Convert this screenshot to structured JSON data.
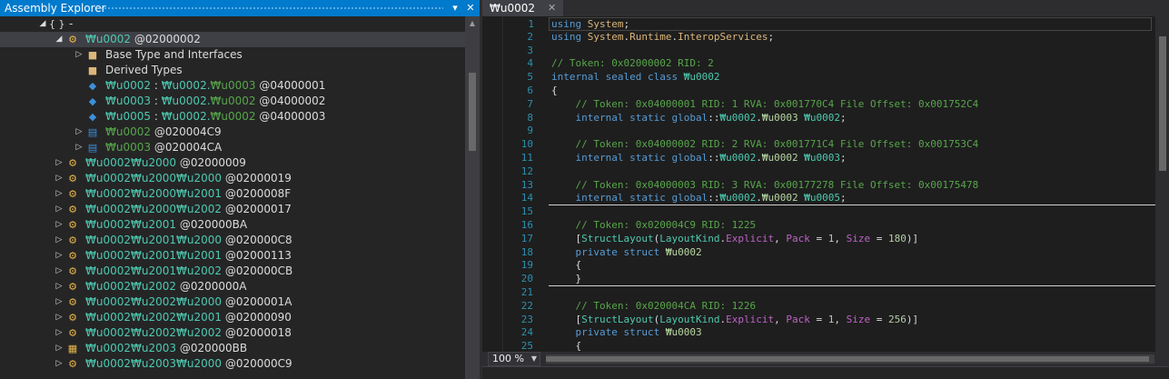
{
  "left_panel": {
    "title": "Assembly Explorer",
    "pin_icon": "pin-icon",
    "close_icon": "close-icon"
  },
  "tree": [
    {
      "indent": 42,
      "arrow": "◢",
      "icon": "braces-icon",
      "icon_glyph": "{ }",
      "parts": [
        {
          "t": "-",
          "c": "c-grey"
        }
      ]
    },
    {
      "indent": 60,
      "arrow": "◢",
      "icon": "class-icon",
      "icon_glyph": "⚙",
      "sel": true,
      "parts": [
        {
          "t": "₩u0002",
          "c": "c-teal"
        },
        {
          "t": " @02000002",
          "c": "c-grey"
        }
      ]
    },
    {
      "indent": 82,
      "arrow": "▷",
      "icon": "folder-icon",
      "icon_glyph": "■",
      "parts": [
        {
          "t": "Base Type and Interfaces",
          "c": "c-grey"
        }
      ]
    },
    {
      "indent": 82,
      "arrow": "",
      "icon": "folder-icon",
      "icon_glyph": "■",
      "parts": [
        {
          "t": "Derived Types",
          "c": "c-grey"
        }
      ]
    },
    {
      "indent": 82,
      "arrow": "",
      "icon": "field-icon",
      "icon_glyph": "◆",
      "parts": [
        {
          "t": "₩u0002",
          "c": "c-teal"
        },
        {
          "t": " : ",
          "c": "c-grey"
        },
        {
          "t": "₩u0002.",
          "c": "c-teal"
        },
        {
          "t": "₩u0003",
          "c": "c-lgreen"
        },
        {
          "t": " @04000001",
          "c": "c-grey"
        }
      ]
    },
    {
      "indent": 82,
      "arrow": "",
      "icon": "field-icon",
      "icon_glyph": "◆",
      "parts": [
        {
          "t": "₩u0003",
          "c": "c-teal"
        },
        {
          "t": " : ",
          "c": "c-grey"
        },
        {
          "t": "₩u0002.",
          "c": "c-teal"
        },
        {
          "t": "₩u0002",
          "c": "c-lgreen"
        },
        {
          "t": " @04000002",
          "c": "c-grey"
        }
      ]
    },
    {
      "indent": 82,
      "arrow": "",
      "icon": "field-icon",
      "icon_glyph": "◆",
      "parts": [
        {
          "t": "₩u0005",
          "c": "c-teal"
        },
        {
          "t": " : ",
          "c": "c-grey"
        },
        {
          "t": "₩u0002.",
          "c": "c-teal"
        },
        {
          "t": "₩u0002",
          "c": "c-lgreen"
        },
        {
          "t": " @04000003",
          "c": "c-grey"
        }
      ]
    },
    {
      "indent": 82,
      "arrow": "▷",
      "icon": "struct-icon",
      "icon_glyph": "▤",
      "parts": [
        {
          "t": "₩u0002",
          "c": "c-lgreen"
        },
        {
          "t": " @020004C9",
          "c": "c-grey"
        }
      ]
    },
    {
      "indent": 82,
      "arrow": "▷",
      "icon": "struct-icon",
      "icon_glyph": "▤",
      "parts": [
        {
          "t": "₩u0003",
          "c": "c-lgreen"
        },
        {
          "t": " @020004CA",
          "c": "c-grey"
        }
      ]
    },
    {
      "indent": 60,
      "arrow": "▷",
      "icon": "class-icon",
      "icon_glyph": "⚙",
      "parts": [
        {
          "t": "₩u0002₩u2000",
          "c": "c-teal"
        },
        {
          "t": " @02000009",
          "c": "c-grey"
        }
      ]
    },
    {
      "indent": 60,
      "arrow": "▷",
      "icon": "class-icon",
      "icon_glyph": "⚙",
      "parts": [
        {
          "t": "₩u0002₩u2000₩u2000",
          "c": "c-teal"
        },
        {
          "t": " @02000019",
          "c": "c-grey"
        }
      ]
    },
    {
      "indent": 60,
      "arrow": "▷",
      "icon": "class-icon",
      "icon_glyph": "⚙",
      "parts": [
        {
          "t": "₩u0002₩u2000₩u2001",
          "c": "c-teal"
        },
        {
          "t": " @0200008F",
          "c": "c-grey"
        }
      ]
    },
    {
      "indent": 60,
      "arrow": "▷",
      "icon": "class-icon",
      "icon_glyph": "⚙",
      "parts": [
        {
          "t": "₩u0002₩u2000₩u2002",
          "c": "c-teal"
        },
        {
          "t": " @02000017",
          "c": "c-grey"
        }
      ]
    },
    {
      "indent": 60,
      "arrow": "▷",
      "icon": "class-icon",
      "icon_glyph": "⚙",
      "parts": [
        {
          "t": "₩u0002₩u2001",
          "c": "c-teal"
        },
        {
          "t": " @020000BA",
          "c": "c-grey"
        }
      ]
    },
    {
      "indent": 60,
      "arrow": "▷",
      "icon": "class-icon",
      "icon_glyph": "⚙",
      "parts": [
        {
          "t": "₩u0002₩u2001₩u2000",
          "c": "c-teal"
        },
        {
          "t": " @020000C8",
          "c": "c-grey"
        }
      ]
    },
    {
      "indent": 60,
      "arrow": "▷",
      "icon": "class-icon",
      "icon_glyph": "⚙",
      "parts": [
        {
          "t": "₩u0002₩u2001₩u2001",
          "c": "c-teal"
        },
        {
          "t": " @02000113",
          "c": "c-grey"
        }
      ]
    },
    {
      "indent": 60,
      "arrow": "▷",
      "icon": "class-icon",
      "icon_glyph": "⚙",
      "parts": [
        {
          "t": "₩u0002₩u2001₩u2002",
          "c": "c-teal"
        },
        {
          "t": " @020000CB",
          "c": "c-grey"
        }
      ]
    },
    {
      "indent": 60,
      "arrow": "▷",
      "icon": "class-icon",
      "icon_glyph": "⚙",
      "parts": [
        {
          "t": "₩u0002₩u2002",
          "c": "c-teal"
        },
        {
          "t": " @0200000A",
          "c": "c-grey"
        }
      ]
    },
    {
      "indent": 60,
      "arrow": "▷",
      "icon": "class-icon",
      "icon_glyph": "⚙",
      "parts": [
        {
          "t": "₩u0002₩u2002₩u2000",
          "c": "c-teal"
        },
        {
          "t": " @0200001A",
          "c": "c-grey"
        }
      ]
    },
    {
      "indent": 60,
      "arrow": "▷",
      "icon": "class-icon",
      "icon_glyph": "⚙",
      "parts": [
        {
          "t": "₩u0002₩u2002₩u2001",
          "c": "c-teal"
        },
        {
          "t": " @02000090",
          "c": "c-grey"
        }
      ]
    },
    {
      "indent": 60,
      "arrow": "▷",
      "icon": "class-icon",
      "icon_glyph": "⚙",
      "parts": [
        {
          "t": "₩u0002₩u2002₩u2002",
          "c": "c-teal"
        },
        {
          "t": " @02000018",
          "c": "c-grey"
        }
      ]
    },
    {
      "indent": 60,
      "arrow": "▷",
      "icon": "enum-icon",
      "icon_glyph": "▦",
      "parts": [
        {
          "t": "₩u0002₩u2003",
          "c": "c-teal"
        },
        {
          "t": " @020000BB",
          "c": "c-grey"
        }
      ]
    },
    {
      "indent": 60,
      "arrow": "▷",
      "icon": "class-icon",
      "icon_glyph": "⚙",
      "parts": [
        {
          "t": "₩u0002₩u2003₩u2000",
          "c": "c-teal"
        },
        {
          "t": " @020000C9",
          "c": "c-grey"
        }
      ]
    }
  ],
  "editor": {
    "tab_label": "₩u0002",
    "tab_close": "✕",
    "zoom": "100 %",
    "lines": [
      {
        "n": "1",
        "cur": true,
        "segs": [
          [
            "kw",
            "using"
          ],
          [
            "pu",
            " "
          ],
          [
            "us",
            "System"
          ],
          [
            "pu",
            ";"
          ]
        ]
      },
      {
        "n": "2",
        "segs": [
          [
            "kw",
            "using"
          ],
          [
            "pu",
            " "
          ],
          [
            "us",
            "System"
          ],
          [
            "pu",
            "."
          ],
          [
            "us",
            "Runtime"
          ],
          [
            "pu",
            "."
          ],
          [
            "us",
            "InteropServices"
          ],
          [
            "pu",
            ";"
          ]
        ]
      },
      {
        "n": "3",
        "segs": []
      },
      {
        "n": "4",
        "segs": [
          [
            "cm",
            "// Token: 0x02000002 RID: 2"
          ]
        ]
      },
      {
        "n": "5",
        "segs": [
          [
            "kw",
            "internal sealed class"
          ],
          [
            "pu",
            " "
          ],
          [
            "ty",
            "₩u0002"
          ]
        ]
      },
      {
        "n": "6",
        "segs": [
          [
            "pu",
            "{"
          ]
        ]
      },
      {
        "n": "7",
        "segs": [
          [
            "pu",
            "    "
          ],
          [
            "cm",
            "// Token: 0x04000001 RID: 1 RVA: 0x001770C4 File Offset: 0x001752C4"
          ]
        ]
      },
      {
        "n": "8",
        "segs": [
          [
            "pu",
            "    "
          ],
          [
            "kw",
            "internal static"
          ],
          [
            "pu",
            " "
          ],
          [
            "kw",
            "global"
          ],
          [
            "pu",
            "::"
          ],
          [
            "ty",
            "₩u0002"
          ],
          [
            "pu",
            "."
          ],
          [
            "en",
            "₩u0003"
          ],
          [
            "pu",
            " "
          ],
          [
            "ty",
            "₩u0002"
          ],
          [
            "pu",
            ";"
          ]
        ]
      },
      {
        "n": "9",
        "segs": []
      },
      {
        "n": "10",
        "segs": [
          [
            "pu",
            "    "
          ],
          [
            "cm",
            "// Token: 0x04000002 RID: 2 RVA: 0x001771C4 File Offset: 0x001753C4"
          ]
        ]
      },
      {
        "n": "11",
        "segs": [
          [
            "pu",
            "    "
          ],
          [
            "kw",
            "internal static"
          ],
          [
            "pu",
            " "
          ],
          [
            "kw",
            "global"
          ],
          [
            "pu",
            "::"
          ],
          [
            "ty",
            "₩u0002"
          ],
          [
            "pu",
            "."
          ],
          [
            "en",
            "₩u0002"
          ],
          [
            "pu",
            " "
          ],
          [
            "ty",
            "₩u0003"
          ],
          [
            "pu",
            ";"
          ]
        ]
      },
      {
        "n": "12",
        "segs": []
      },
      {
        "n": "13",
        "segs": [
          [
            "pu",
            "    "
          ],
          [
            "cm",
            "// Token: 0x04000003 RID: 3 RVA: 0x00177278 File Offset: 0x00175478"
          ]
        ]
      },
      {
        "n": "14",
        "segs": [
          [
            "pu",
            "    "
          ],
          [
            "kw",
            "internal static"
          ],
          [
            "pu",
            " "
          ],
          [
            "kw",
            "global"
          ],
          [
            "pu",
            "::"
          ],
          [
            "ty",
            "₩u0002"
          ],
          [
            "pu",
            "."
          ],
          [
            "en",
            "₩u0002"
          ],
          [
            "pu",
            " "
          ],
          [
            "ty",
            "₩u0005"
          ],
          [
            "pu",
            ";"
          ]
        ]
      },
      {
        "n": "15",
        "segs": []
      },
      {
        "n": "16",
        "segs": [
          [
            "pu",
            "    "
          ],
          [
            "cm",
            "// Token: 0x020004C9 RID: 1225"
          ]
        ]
      },
      {
        "n": "17",
        "segs": [
          [
            "pu",
            "    ["
          ],
          [
            "ty",
            "StructLayout"
          ],
          [
            "pu",
            "("
          ],
          [
            "ty",
            "LayoutKind"
          ],
          [
            "pu",
            "."
          ],
          [
            "fl",
            "Explicit"
          ],
          [
            "pu",
            ", "
          ],
          [
            "fl",
            "Pack"
          ],
          [
            "pu",
            " = "
          ],
          [
            "nu",
            "1"
          ],
          [
            "pu",
            ", "
          ],
          [
            "fl",
            "Size"
          ],
          [
            "pu",
            " = "
          ],
          [
            "nu",
            "180"
          ],
          [
            "pu",
            ")]"
          ]
        ]
      },
      {
        "n": "18",
        "segs": [
          [
            "pu",
            "    "
          ],
          [
            "kw",
            "private struct"
          ],
          [
            "pu",
            " "
          ],
          [
            "en",
            "₩u0002"
          ]
        ]
      },
      {
        "n": "19",
        "segs": [
          [
            "pu",
            "    {"
          ]
        ]
      },
      {
        "n": "20",
        "segs": [
          [
            "pu",
            "    }"
          ]
        ]
      },
      {
        "n": "21",
        "segs": []
      },
      {
        "n": "22",
        "segs": [
          [
            "pu",
            "    "
          ],
          [
            "cm",
            "// Token: 0x020004CA RID: 1226"
          ]
        ]
      },
      {
        "n": "23",
        "segs": [
          [
            "pu",
            "    ["
          ],
          [
            "ty",
            "StructLayout"
          ],
          [
            "pu",
            "("
          ],
          [
            "ty",
            "LayoutKind"
          ],
          [
            "pu",
            "."
          ],
          [
            "fl",
            "Explicit"
          ],
          [
            "pu",
            ", "
          ],
          [
            "fl",
            "Pack"
          ],
          [
            "pu",
            " = "
          ],
          [
            "nu",
            "1"
          ],
          [
            "pu",
            ", "
          ],
          [
            "fl",
            "Size"
          ],
          [
            "pu",
            " = "
          ],
          [
            "nu",
            "256"
          ],
          [
            "pu",
            ")]"
          ]
        ]
      },
      {
        "n": "24",
        "segs": [
          [
            "pu",
            "    "
          ],
          [
            "kw",
            "private struct"
          ],
          [
            "pu",
            " "
          ],
          [
            "en",
            "₩u0003"
          ]
        ]
      },
      {
        "n": "25",
        "segs": [
          [
            "pu",
            "    {"
          ]
        ]
      }
    ]
  }
}
